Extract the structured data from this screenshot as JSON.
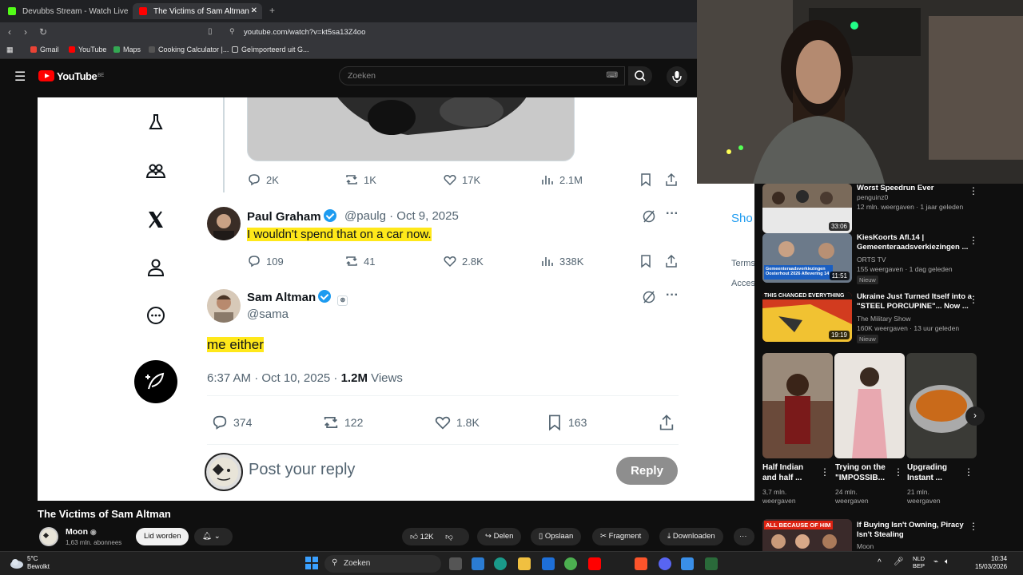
{
  "browser": {
    "tabs": [
      {
        "title": "Devubbs Stream - Watch Live on",
        "active": false
      },
      {
        "title": "The Victims of Sam Altman -",
        "active": true
      }
    ],
    "url": "youtube.com/watch?v=kt5sa13Z4oo",
    "bookmarks": [
      "Gmail",
      "YouTube",
      "Maps",
      "Cooking Calculator |...",
      "Geïmporteerd uit G..."
    ]
  },
  "youtube": {
    "logo_text": "YouTube",
    "logo_country": "BE",
    "search_placeholder": "Zoeken",
    "video_title": "The Victims of Sam Altman",
    "channel": {
      "name": "Moon",
      "subscribers": "1,63 mln. abonnees",
      "join_label": "Lid worden"
    },
    "actions": {
      "likes": "12K",
      "share": "Delen",
      "save": "Opslaan",
      "clip": "Fragment",
      "download": "Downloaden"
    }
  },
  "tweet_view": {
    "top_actions": {
      "replies": "2K",
      "reposts": "1K",
      "likes": "17K",
      "views": "2.1M"
    },
    "reply": {
      "name": "Paul Graham",
      "handle": "@paulg",
      "date": "Oct 9, 2025",
      "text": "I wouldn't spend that on a car now.",
      "replies": "109",
      "reposts": "41",
      "likes": "2.8K",
      "views": "338K"
    },
    "main": {
      "name": "Sam Altman",
      "handle": "@sama",
      "text": "me either",
      "timestamp": "6:37 AM · Oct 10, 2025 · ",
      "views_count": "1.2M",
      "views_label": " Views",
      "replies": "374",
      "reposts": "122",
      "likes": "1.8K",
      "bookmarks": "163"
    },
    "reply_placeholder": "Post your reply",
    "reply_button": "Reply",
    "side_texts": {
      "show": "Sho",
      "terms": "Terms",
      "access": "Acces"
    }
  },
  "recommendations": [
    {
      "title": "Worst Speedrun Ever",
      "channel": "penguinz0",
      "meta": "12 mln. weergaven · 1 jaar geleden",
      "duration": "33:06",
      "badge": ""
    },
    {
      "title": "KiesKoorts Afl.14 | Gemeenteraadsverkiezingen ...",
      "channel": "ORTS TV",
      "meta": "155 weergaven · 1 dag geleden",
      "duration": "11:51",
      "badge": "Nieuw"
    },
    {
      "title": "Ukraine Just Turned Itself into a \"STEEL PORCUPINE\"... Now ...",
      "channel": "The Military Show",
      "meta": "160K weergaven · 13 uur geleden",
      "duration": "19:19",
      "badge": "Nieuw"
    }
  ],
  "shorts": [
    {
      "title": "Half Indian and half ...",
      "meta1": "3,7 mln.",
      "meta2": "weergaven"
    },
    {
      "title": "Trying on the \"IMPOSSIB...",
      "meta1": "24 mln.",
      "meta2": "weergaven"
    },
    {
      "title": "Upgrading Instant ...",
      "meta1": "21 mln.",
      "meta2": "weergaven"
    }
  ],
  "bottom_rec": {
    "title": "If Buying Isn't Owning, Piracy Isn't Stealing",
    "channel": "Moon",
    "thumb_text": "ALL BECAUSE OF HIM"
  },
  "thumb_texts": {
    "rec2_overlay": "Gemeenteraadsverkiezingen Oosterhout 2026 Aflevering 14",
    "rec3_overlay": "THIS CHANGED EVERYTHING"
  },
  "taskbar": {
    "weather_temp": "5°C",
    "weather_desc": "Bewolkt",
    "search": "Zoeken",
    "lang": "NLD",
    "lang2": "BEP",
    "time": "10:34",
    "date": "15/03/2026"
  },
  "colors": {
    "accent_blue": "#1d9bf0",
    "highlight": "#ffe81a",
    "yt_red": "#ff0000"
  }
}
